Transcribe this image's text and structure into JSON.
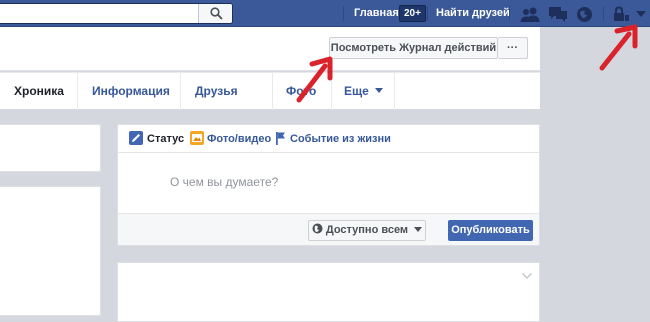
{
  "topbar": {
    "search_placeholder": "",
    "nav": {
      "home": "Главная",
      "home_badge": "20+",
      "find_friends": "Найти друзей"
    },
    "icons": [
      "search-icon",
      "friend-requests-icon",
      "messages-icon",
      "notifications-icon",
      "privacy-shortcuts-icon",
      "account-menu-icon"
    ]
  },
  "cover": {
    "activity_log_button": "Посмотреть Журнал действий",
    "more_button": "···"
  },
  "tabs": [
    {
      "label": "Хроника"
    },
    {
      "label": "Информация"
    },
    {
      "label": "Друзья"
    },
    {
      "label": "Фото"
    },
    {
      "label": "Еще"
    }
  ],
  "composer": {
    "tabs": [
      {
        "label": "Статус",
        "icon": "status-pencil-icon"
      },
      {
        "label": "Фото/видео",
        "icon": "photo-video-icon"
      },
      {
        "label": "Событие из жизни",
        "icon": "life-event-flag-icon"
      }
    ],
    "placeholder": "О чем вы думаете?",
    "audience_selector": "Доступно всем",
    "publish_button": "Опубликовать"
  },
  "colors": {
    "brand": "#3b5998",
    "button_blue": "#4267b2",
    "link": "#365899",
    "annotation_arrow": "#d9222a"
  }
}
